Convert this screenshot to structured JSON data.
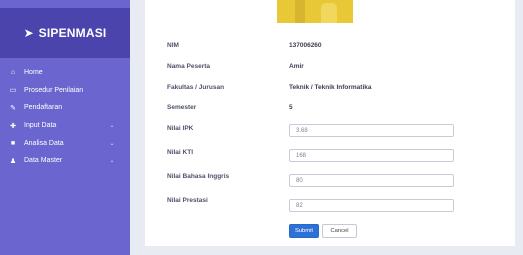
{
  "sidebar": {
    "brand": "SIPENMASI",
    "items": [
      {
        "label": "Home",
        "icon": "home-icon",
        "has_caret": false
      },
      {
        "label": "Prosedur Penilaian",
        "icon": "inbox-icon",
        "has_caret": false
      },
      {
        "label": "Pendaftaran",
        "icon": "pencil-icon",
        "has_caret": false
      },
      {
        "label": "Input Data",
        "icon": "plus-icon",
        "has_caret": true
      },
      {
        "label": "Analisa Data",
        "icon": "table-icon",
        "has_caret": true
      },
      {
        "label": "Data Master",
        "icon": "user-icon",
        "has_caret": true
      }
    ]
  },
  "form": {
    "nim_label": "NIM",
    "nim_value": "137006260",
    "nama_label": "Nama Peserta",
    "nama_value": "Amir",
    "fakultas_label": "Fakultas / Jurusan",
    "fakultas_value": "Teknik / Teknik Informatika",
    "semester_label": "Semester",
    "semester_value": "5",
    "ipk_label": "Nilai IPK",
    "ipk_value": "3.68",
    "kti_label": "Nilai KTI",
    "kti_value": "168",
    "bahasa_label": "Nilai Bahasa Inggris",
    "bahasa_value": "80",
    "prestasi_label": "Nilai Prestasi",
    "prestasi_value": "82",
    "submit_label": "Submit",
    "cancel_label": "Cancel"
  },
  "colors": {
    "sidebar_bg": "#6b66cf",
    "brand_bg": "#4b44ad",
    "submit_bg": "#2d71d6"
  }
}
